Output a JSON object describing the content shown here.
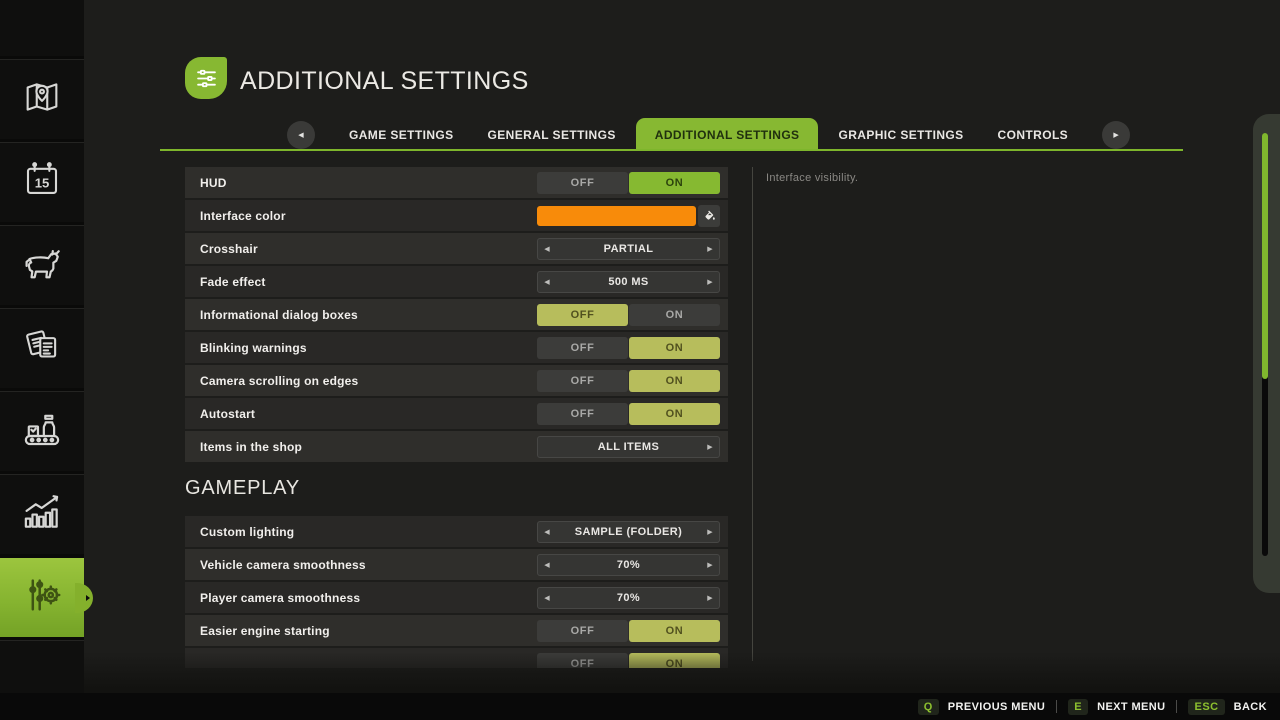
{
  "header": {
    "title": "ADDITIONAL SETTINGS",
    "icon": "sliders-icon"
  },
  "tabs": {
    "prev_icon": "chevron-left-icon",
    "next_icon": "chevron-right-icon",
    "items": [
      {
        "label": "GAME SETTINGS"
      },
      {
        "label": "GENERAL SETTINGS"
      },
      {
        "label": "ADDITIONAL SETTINGS",
        "active": true
      },
      {
        "label": "GRAPHIC SETTINGS"
      },
      {
        "label": "CONTROLS"
      }
    ]
  },
  "toggle": {
    "off": "OFF",
    "on": "ON"
  },
  "sections": [
    {
      "title": "",
      "rows": [
        {
          "label": "HUD",
          "type": "toggle",
          "value": "ON",
          "focused": true
        },
        {
          "label": "Interface color",
          "type": "color",
          "color": "#F88B0A",
          "picker_icon": "paint-icon"
        },
        {
          "label": "Crosshair",
          "type": "selector",
          "value": "PARTIAL",
          "arrows": "both"
        },
        {
          "label": "Fade effect",
          "type": "selector",
          "value": "500 MS",
          "arrows": "both"
        },
        {
          "label": "Informational dialog boxes",
          "type": "toggle",
          "value": "OFF"
        },
        {
          "label": "Blinking warnings",
          "type": "toggle",
          "value": "ON"
        },
        {
          "label": "Camera scrolling on edges",
          "type": "toggle",
          "value": "ON"
        },
        {
          "label": "Autostart",
          "type": "toggle",
          "value": "ON"
        },
        {
          "label": "Items in the shop",
          "type": "selector",
          "value": "ALL ITEMS",
          "arrows": "right"
        }
      ]
    },
    {
      "title": "GAMEPLAY",
      "rows": [
        {
          "label": "Custom lighting",
          "type": "selector",
          "value": "SAMPLE (FOLDER)",
          "arrows": "both"
        },
        {
          "label": "Vehicle camera smoothness",
          "type": "selector",
          "value": "70%",
          "arrows": "both"
        },
        {
          "label": "Player camera smoothness",
          "type": "selector",
          "value": "70%",
          "arrows": "both"
        },
        {
          "label": "Easier engine starting",
          "type": "toggle",
          "value": "ON"
        },
        {
          "label": "",
          "type": "toggle",
          "value": "ON",
          "partial": true
        }
      ]
    }
  ],
  "description": "Interface visibility.",
  "sidebar": {
    "items": [
      {
        "name": "map",
        "icon": "map-icon"
      },
      {
        "name": "calendar",
        "icon": "calendar-icon",
        "day": "15"
      },
      {
        "name": "animals",
        "icon": "animals-icon"
      },
      {
        "name": "contracts",
        "icon": "contracts-icon"
      },
      {
        "name": "production",
        "icon": "production-icon"
      },
      {
        "name": "statistics",
        "icon": "statistics-icon"
      },
      {
        "name": "settings",
        "icon": "settings-icon",
        "active": true
      }
    ]
  },
  "footer": {
    "items": [
      {
        "key": "Q",
        "label": "PREVIOUS MENU"
      },
      {
        "key": "E",
        "label": "NEXT MENU"
      },
      {
        "key": "ESC",
        "label": "BACK"
      }
    ]
  },
  "colors": {
    "accent_green": "#85B72F",
    "muted_green": "#B7BD5C",
    "interface_orange": "#F88B0A"
  }
}
